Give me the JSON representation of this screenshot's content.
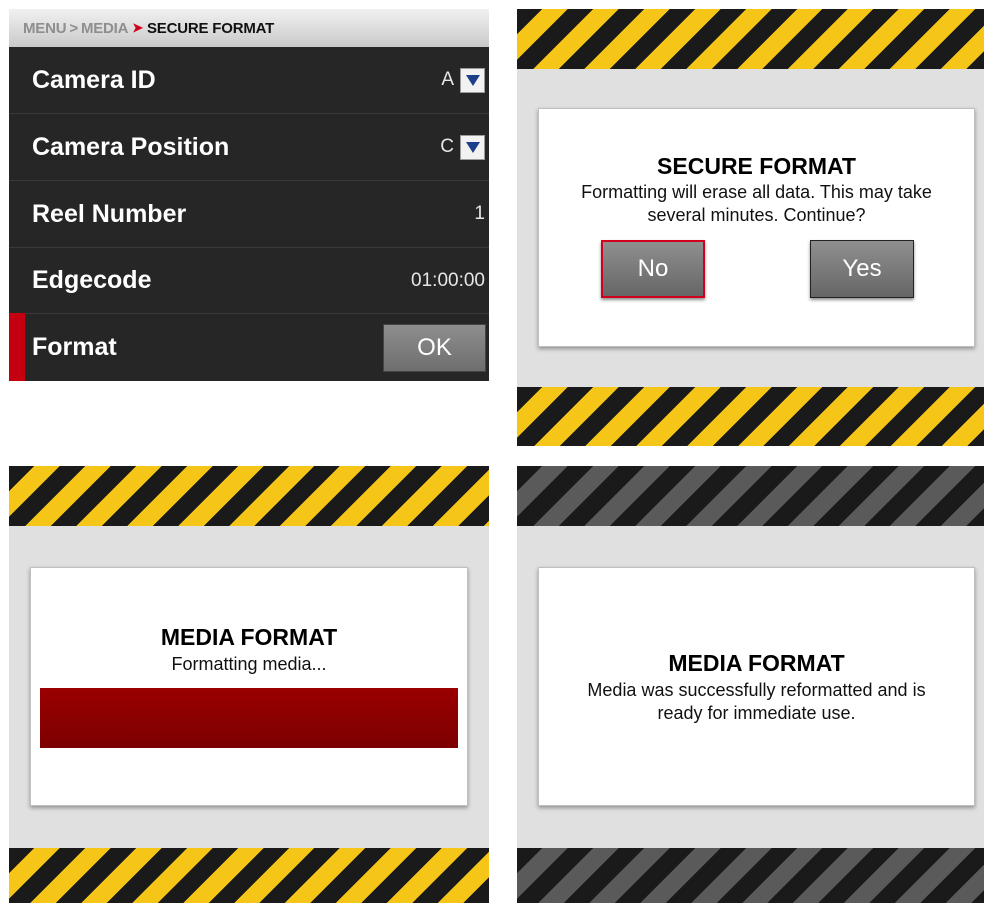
{
  "menu_screen": {
    "breadcrumb": {
      "item1": "MENU",
      "sep": ">",
      "item2": "MEDIA",
      "item3": "SECURE FORMAT"
    },
    "rows": [
      {
        "label": "Camera ID",
        "value": "A"
      },
      {
        "label": "Camera Position",
        "value": "C"
      },
      {
        "label": "Reel Number",
        "value": "1"
      },
      {
        "label": "Edgecode",
        "value": "01:00:00"
      },
      {
        "label": "Format",
        "button": "OK"
      }
    ],
    "dropdown_icon": "chevron-down-icon"
  },
  "confirm_dialog": {
    "title": "SECURE FORMAT",
    "message_line1": "Formatting will erase all data. This may take",
    "message_line2": "several minutes. Continue?",
    "no_label": "No",
    "yes_label": "Yes"
  },
  "progress_dialog": {
    "title": "MEDIA FORMAT",
    "message": "Formatting media...",
    "progress_color": "#8b0000"
  },
  "success_dialog": {
    "title": "MEDIA FORMAT",
    "message_line1": "Media was successfully reformatted and is",
    "message_line2": "ready for immediate use."
  },
  "colors": {
    "hazard_yellow": "#f5c518",
    "hazard_black": "#1a1a1a",
    "hazard_gray": "#5a5a5a",
    "accent_red": "#c40010"
  }
}
